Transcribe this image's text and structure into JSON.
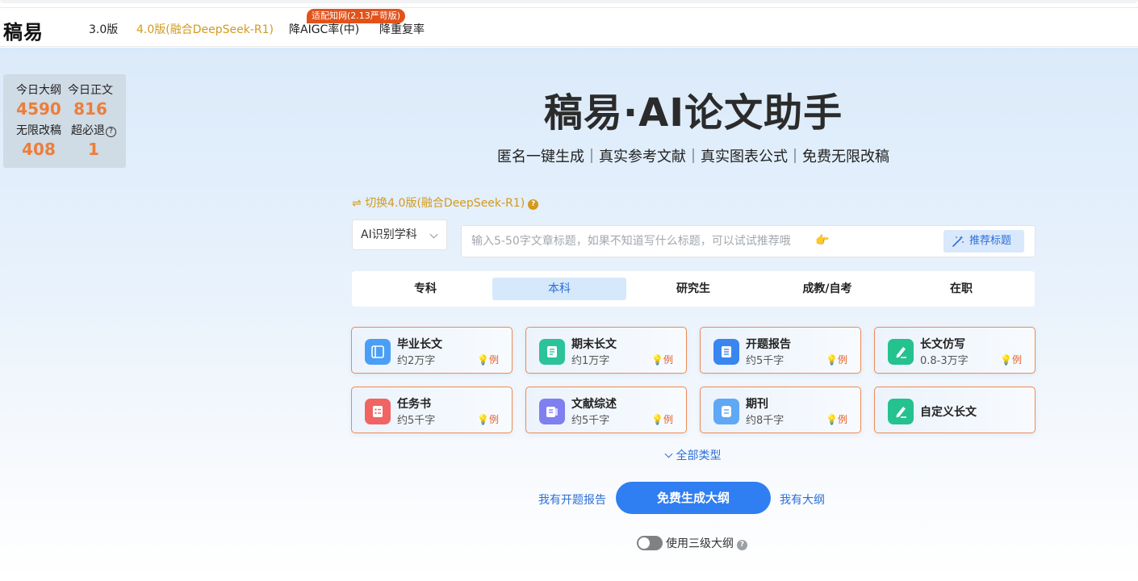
{
  "nav": {
    "logo": "稿易",
    "items": [
      {
        "label": "3.0版",
        "active": false
      },
      {
        "label": "4.0版(融合DeepSeek-R1)",
        "active": true
      },
      {
        "label": "降AIGC率(中)",
        "active": false
      },
      {
        "label": "降重复率",
        "active": false
      }
    ],
    "badge": "适配知网(2.13严苛版)"
  },
  "stats": {
    "items": [
      {
        "label": "今日大纲",
        "value": "4590"
      },
      {
        "label": "今日正文",
        "value": "816"
      },
      {
        "label": "无限改稿",
        "value": "408"
      },
      {
        "label": "超必退",
        "value": "1"
      }
    ],
    "help_icon": "?"
  },
  "hero": {
    "title": "稿易·AI论文助手",
    "subtitle": "匿名一键生成｜真实参考文献｜真实图表公式｜免费无限改稿"
  },
  "version_switch": {
    "icon": "⇌",
    "label": "切换4.0版(融合DeepSeek-R1)",
    "help": "?"
  },
  "subject_select": {
    "value": "AI识别学科"
  },
  "title_input": {
    "placeholder": "输入5-50字文章标题，如果不知道写什么标题，可以试试推荐哦",
    "emoji": "👉",
    "recommend_label": "推荐标题"
  },
  "levels": [
    {
      "label": "专科",
      "active": false
    },
    {
      "label": "本科",
      "active": true
    },
    {
      "label": "研究生",
      "active": false
    },
    {
      "label": "成教/自考",
      "active": false
    },
    {
      "label": "在职",
      "active": false
    }
  ],
  "example_label": "例",
  "cards": [
    {
      "name": "毕业长文",
      "desc": "约2万字",
      "icon": "book-icon",
      "color": "#4a9ff5"
    },
    {
      "name": "期末长文",
      "desc": "约1万字",
      "icon": "document-icon",
      "color": "#2cc39a"
    },
    {
      "name": "开题报告",
      "desc": "约5千字",
      "icon": "report-icon",
      "color": "#3a86f0"
    },
    {
      "name": "长文仿写",
      "desc": "0.8-3万字",
      "icon": "pen-icon",
      "color": "#24c28e"
    },
    {
      "name": "任务书",
      "desc": "约5千字",
      "icon": "task-list-icon",
      "color": "#f06464"
    },
    {
      "name": "文献综述",
      "desc": "约5千字",
      "icon": "literature-icon",
      "color": "#7f7ff0"
    },
    {
      "name": "期刊",
      "desc": "约8千字",
      "icon": "journal-icon",
      "color": "#5fa8f5"
    },
    {
      "name": "自定义长文",
      "desc": "",
      "icon": "pen-icon",
      "color": "#24c28e"
    }
  ],
  "all_types_label": "全部类型",
  "actions": {
    "have_proposal": "我有开题报告",
    "generate": "免费生成大纲",
    "have_outline": "我有大纲"
  },
  "three_level": {
    "label": "使用三级大纲",
    "enabled": false,
    "help": "?"
  }
}
